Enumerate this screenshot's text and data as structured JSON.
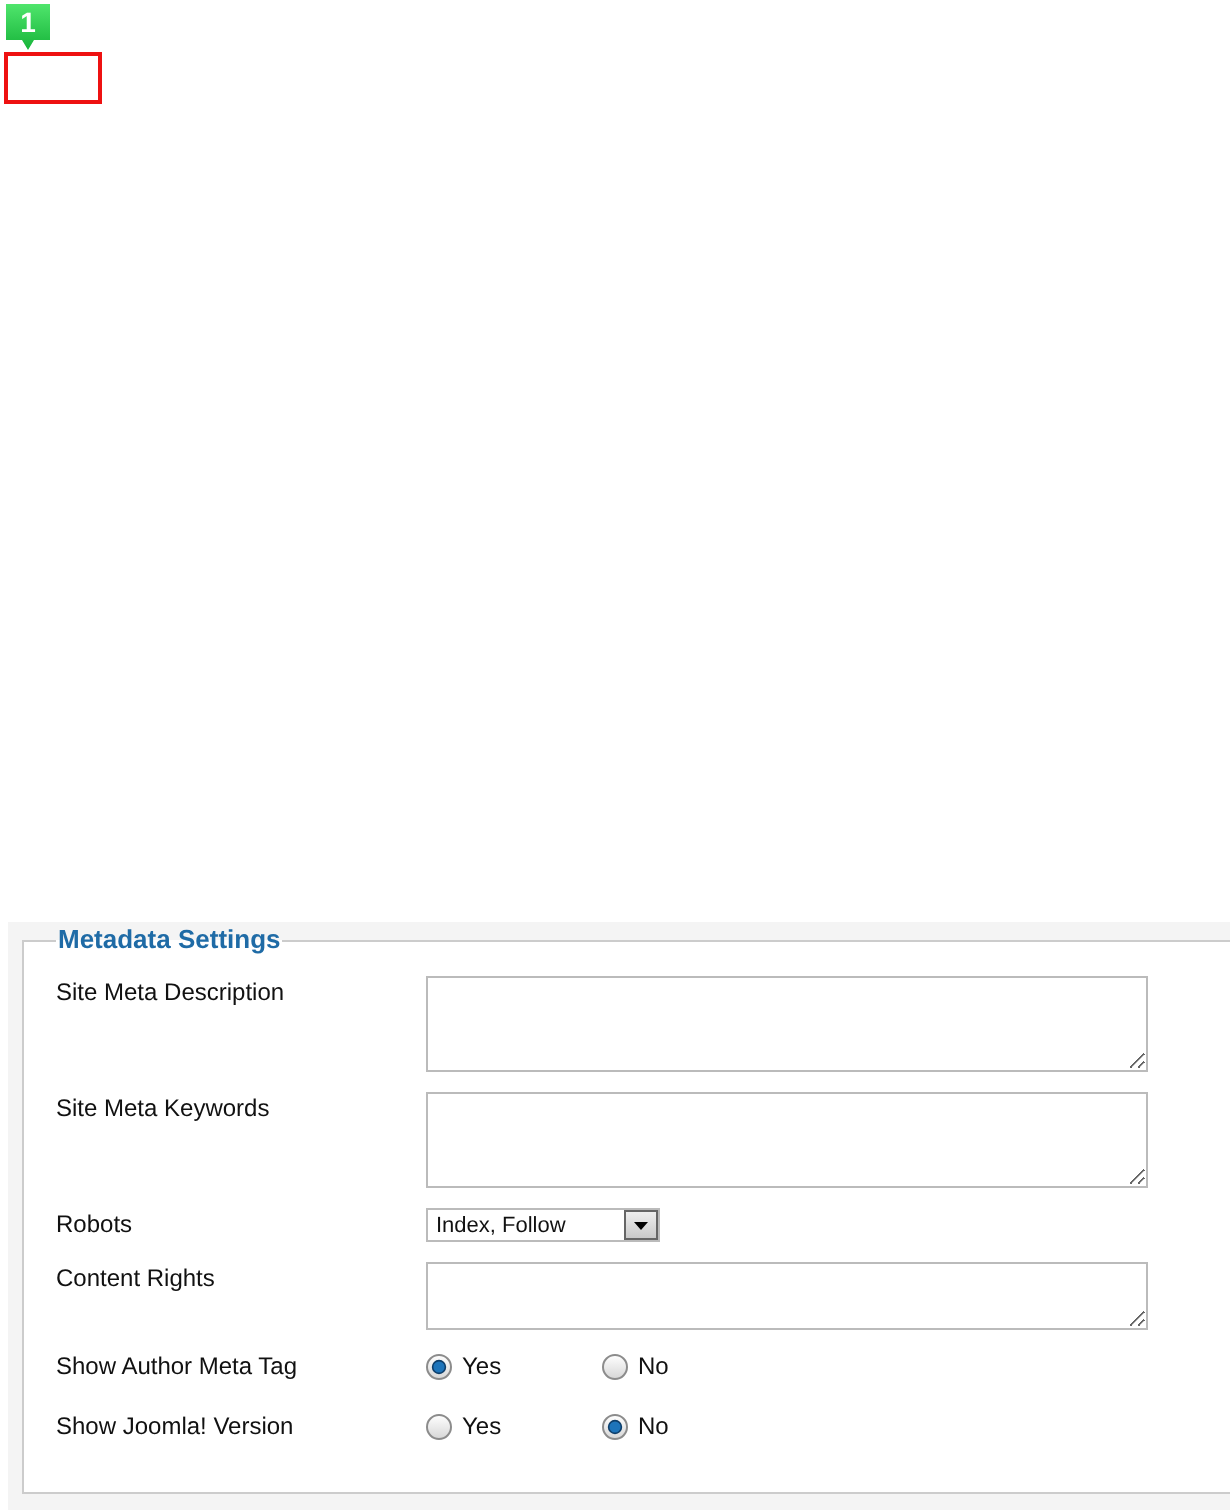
{
  "annotation": {
    "badge": "1"
  },
  "fieldset": {
    "legend": "Metadata Settings",
    "fields": [
      {
        "kind": "textarea",
        "label": "Site Meta Description"
      },
      {
        "kind": "textarea",
        "label": "Site Meta Keywords"
      },
      {
        "kind": "select",
        "label": "Robots",
        "value": "Index, Follow"
      },
      {
        "kind": "textarea",
        "label": "Content Rights"
      },
      {
        "kind": "radio",
        "label": "Show Author Meta Tag",
        "options": [
          {
            "label": "Yes",
            "selected": true
          },
          {
            "label": "No",
            "selected": false
          }
        ]
      },
      {
        "kind": "radio",
        "label": "Show Joomla! Version",
        "options": [
          {
            "label": "Yes",
            "selected": false
          },
          {
            "label": "No",
            "selected": true
          }
        ]
      }
    ]
  }
}
